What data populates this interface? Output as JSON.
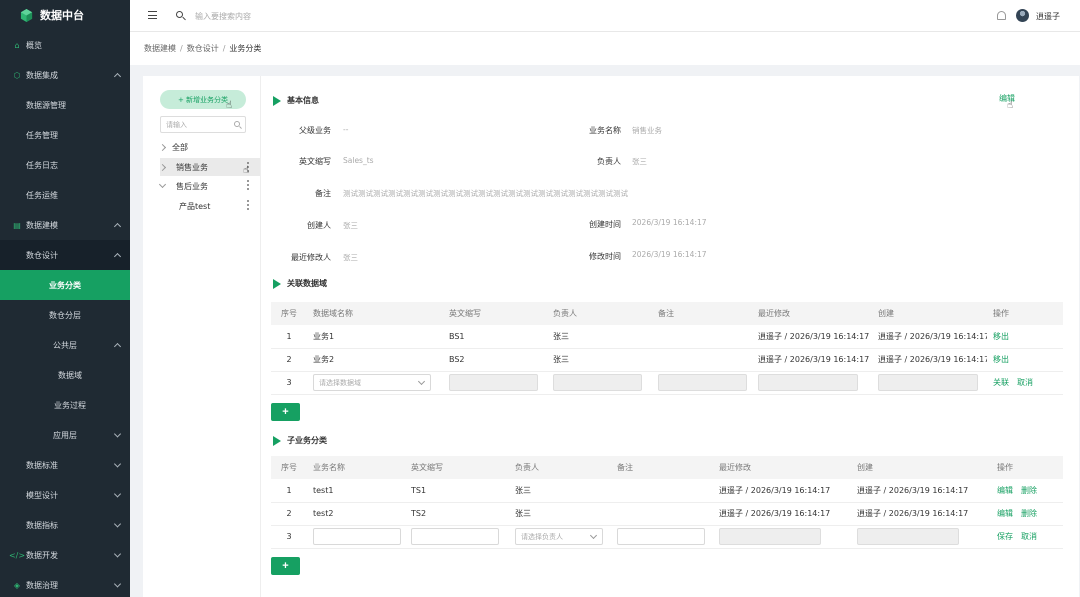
{
  "app": {
    "title": "数据中台"
  },
  "sidebar": {
    "items": [
      {
        "label": "概览",
        "icon": "home-icon"
      },
      {
        "label": "数据集成",
        "icon": "integration-icon"
      },
      {
        "label": "数据源管理"
      },
      {
        "label": "任务管理"
      },
      {
        "label": "任务日志"
      },
      {
        "label": "任务运维"
      },
      {
        "label": "数据建模",
        "icon": "modeling-icon"
      },
      {
        "label": "数仓设计"
      },
      {
        "label": "业务分类"
      },
      {
        "label": "数仓分层"
      },
      {
        "label": "公共层"
      },
      {
        "label": "数据域"
      },
      {
        "label": "业务过程"
      },
      {
        "label": "应用层"
      },
      {
        "label": "数据标准"
      },
      {
        "label": "模型设计"
      },
      {
        "label": "数据指标"
      },
      {
        "label": "数据开发",
        "icon": "code-icon"
      },
      {
        "label": "数据治理",
        "icon": "governance-icon"
      }
    ]
  },
  "topbar": {
    "search_placeholder": "输入要搜索内容",
    "username": "逍遥子"
  },
  "breadcrumb": [
    "数据建模",
    "数仓设计",
    "业务分类"
  ],
  "tree": {
    "add_label": "+ 新增业务分类",
    "search_placeholder": "请输入",
    "nodes": [
      "全部",
      "销售业务",
      "售后业务",
      "产品test"
    ]
  },
  "basic": {
    "title": "基本信息",
    "edit_label": "编辑",
    "parent_label": "父级业务",
    "parent_value": "--",
    "name_label": "业务名称",
    "name_value": "销售业务",
    "abbr_label": "英文缩写",
    "abbr_value": "Sales_ts",
    "owner_label": "负责人",
    "owner_value": "张三",
    "note_label": "备注",
    "note_value": "测试测试测试测试测试测试测试测试测试测试测试测试测试测试测试测试测试测试测试",
    "creator_label": "创建人",
    "creator_value": "张三",
    "created_label": "创建时间",
    "created_value": "2026/3/19 16:14:17",
    "modifier_label": "最近修改人",
    "modifier_value": "张三",
    "modified_label": "修改时间",
    "modified_value": "2026/3/19 16:14:17"
  },
  "domains": {
    "title": "关联数据域",
    "headers": [
      "序号",
      "数据域名称",
      "英文缩写",
      "负责人",
      "备注",
      "最近修改",
      "创建",
      "操作"
    ],
    "rows": [
      {
        "idx": "1",
        "name": "业务1",
        "abbr": "BS1",
        "owner": "张三",
        "note": "",
        "modified": "逍遥子 / 2026/3/19 16:14:17",
        "created": "逍遥子 / 2026/3/19 16:14:17",
        "action": "移出"
      },
      {
        "idx": "2",
        "name": "业务2",
        "abbr": "BS2",
        "owner": "张三",
        "note": "",
        "modified": "逍遥子 / 2026/3/19 16:14:17",
        "created": "逍遥子 / 2026/3/19 16:14:17",
        "action": "移出"
      }
    ],
    "new_row": {
      "idx": "3",
      "select_placeholder": "请选择数据域",
      "action1": "关联",
      "action2": "取消"
    },
    "add_label": "+"
  },
  "children": {
    "title": "子业务分类",
    "headers": [
      "序号",
      "业务名称",
      "英文缩写",
      "负责人",
      "备注",
      "最近修改",
      "创建",
      "操作"
    ],
    "rows": [
      {
        "idx": "1",
        "name": "test1",
        "abbr": "TS1",
        "owner": "张三",
        "note": "",
        "modified": "逍遥子 / 2026/3/19 16:14:17",
        "created": "逍遥子 / 2026/3/19 16:14:17",
        "action1": "编辑",
        "action2": "删除"
      },
      {
        "idx": "2",
        "name": "test2",
        "abbr": "TS2",
        "owner": "张三",
        "note": "",
        "modified": "逍遥子 / 2026/3/19 16:14:17",
        "created": "逍遥子 / 2026/3/19 16:14:17",
        "action1": "编辑",
        "action2": "删除"
      }
    ],
    "new_row": {
      "idx": "3",
      "select_placeholder": "请选择负责人",
      "action1": "保存",
      "action2": "取消"
    },
    "add_label": "+"
  },
  "colors": {
    "accent": "#16a062",
    "sidebar_bg": "#1f2a33",
    "add_btn_bg": "#c6ecd9"
  }
}
